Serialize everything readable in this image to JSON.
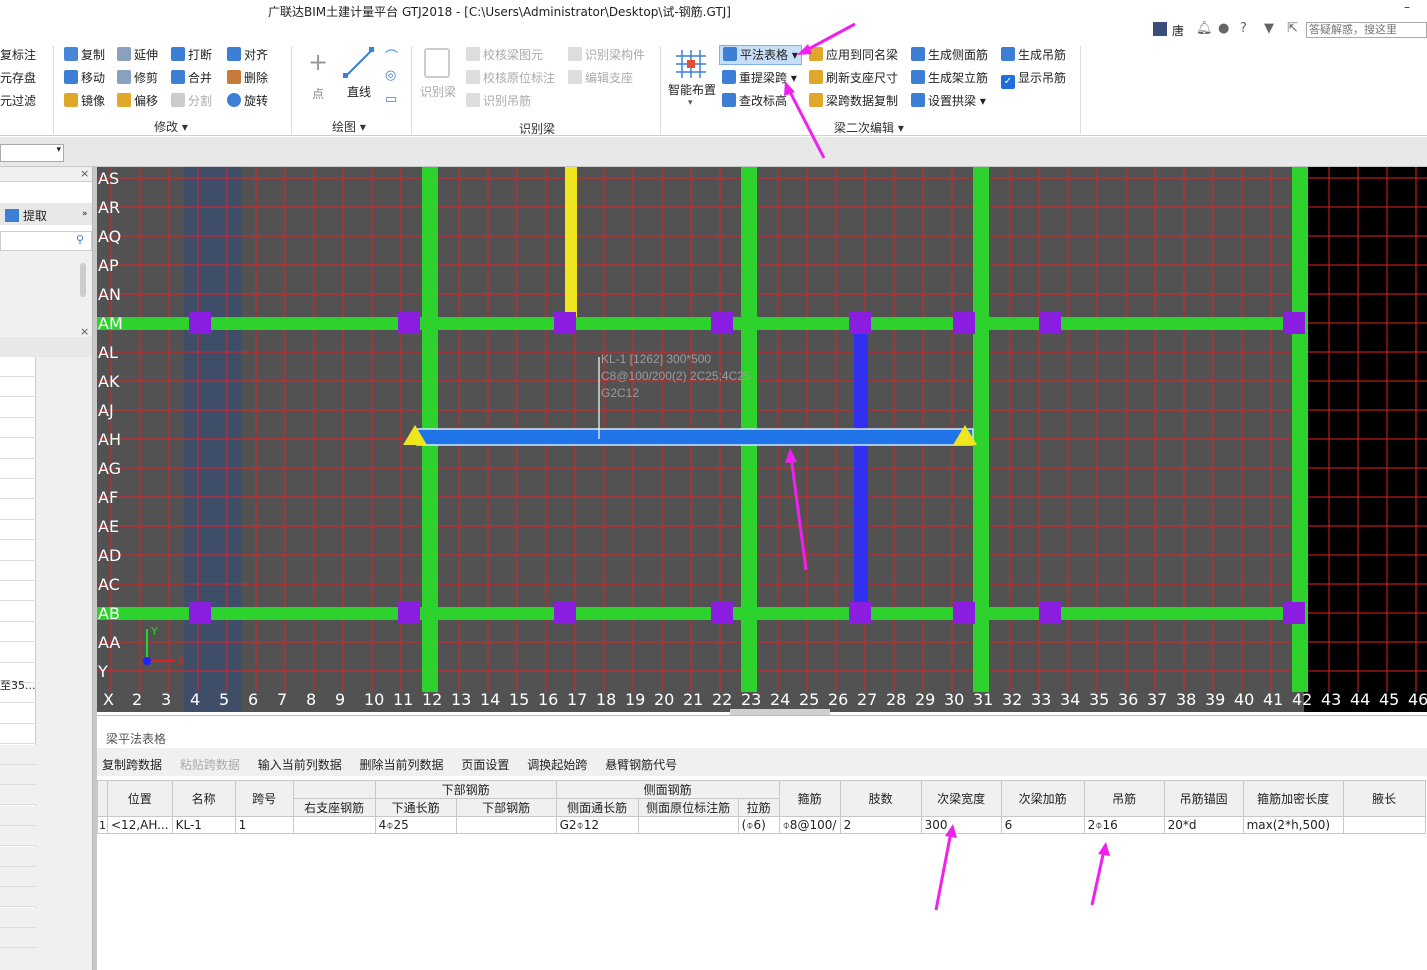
{
  "window": {
    "title": "广联达BIM土建计量平台 GTJ2018 - [C:\\Users\\Administrator\\Desktop\\试-钢筋.GTJ]",
    "minimize": "–"
  },
  "topright": {
    "user": "唐",
    "search_placeholder": "答疑解惑，搜这里"
  },
  "ribbon": {
    "col0": [
      "复标注",
      "元存盘",
      "元过滤"
    ],
    "modify": {
      "items": [
        [
          "复制",
          "延伸",
          "打断",
          "对齐"
        ],
        [
          "移动",
          "修剪",
          "合并",
          "删除"
        ],
        [
          "镜像",
          "偏移",
          "分割",
          "旋转"
        ]
      ],
      "group": "修改"
    },
    "draw": {
      "point": "点",
      "line": "直线",
      "group": "绘图"
    },
    "identify": {
      "big": "识别梁",
      "items": [
        "校核梁图元",
        "校核原位标注",
        "识别吊筋",
        "识别梁构件",
        "编辑支座"
      ],
      "group": "识别梁"
    },
    "edit2": {
      "smart": "智能布置",
      "items": [
        "平法表格",
        "重提梁跨",
        "查改标高",
        "应用到同名梁",
        "刷新支座尺寸",
        "梁跨数据复制",
        "生成侧面筋",
        "生成架立筋",
        "设置拱梁",
        "生成吊筋",
        "显示吊筋"
      ],
      "group": "梁二次编辑"
    }
  },
  "leftpanel": {
    "extract": "提取",
    "truncated": "至35..."
  },
  "canvas": {
    "rows": [
      "AS",
      "AR",
      "AQ",
      "AP",
      "AN",
      "AM",
      "AL",
      "AK",
      "AJ",
      "AH",
      "AG",
      "AF",
      "AE",
      "AD",
      "AC",
      "AB",
      "AA",
      "Y"
    ],
    "cols": [
      "X",
      "2",
      "3",
      "4",
      "5",
      "6",
      "7",
      "8",
      "9",
      "10",
      "11",
      "12",
      "13",
      "14",
      "15",
      "16",
      "17",
      "18",
      "19",
      "20",
      "21",
      "22",
      "23",
      "24",
      "25",
      "26",
      "27",
      "28",
      "29",
      "30",
      "31",
      "32",
      "33",
      "34",
      "35",
      "36",
      "37",
      "38",
      "39",
      "40",
      "41",
      "42",
      "43",
      "44",
      "45",
      "46",
      "4"
    ],
    "beam_label": [
      "KL-1 [1262] 300*500",
      "C8@100/200(2) 2C25;4C25",
      "G2C12"
    ],
    "axis_x": "X",
    "axis_y": "Y"
  },
  "bottom": {
    "title": "梁平法表格",
    "tools": [
      "复制跨数据",
      "粘贴跨数据",
      "输入当前列数据",
      "删除当前列数据",
      "页面设置",
      "调换起始跨",
      "悬臂钢筋代号"
    ],
    "headers_top": {
      "lower": "下部钢筋",
      "side": "侧面钢筋"
    },
    "headers": [
      "位置",
      "名称",
      "跨号",
      "右支座钢筋",
      "下通长筋",
      "下部钢筋",
      "侧面通长筋",
      "侧面原位标注筋",
      "拉筋",
      "箍筋",
      "肢数",
      "次梁宽度",
      "次梁加筋",
      "吊筋",
      "吊筋锚固",
      "箍筋加密长度",
      "腋长"
    ],
    "row": {
      "idx": "1",
      "cells": [
        "<12,AH...",
        "KL-1",
        "1",
        "",
        "4⌽25",
        "",
        "G2⌽12",
        "",
        "(⌽6)",
        "⌽8@100/",
        "2",
        "300",
        "6",
        "2⌽16",
        "20*d",
        "max(2*h,500)",
        ""
      ]
    }
  },
  "colors": {
    "grid": "#e02020",
    "column_green": "#2dd22d",
    "pillar": "#8a1de0",
    "beam": "#1f74e8",
    "highlight": "#f020f0"
  }
}
